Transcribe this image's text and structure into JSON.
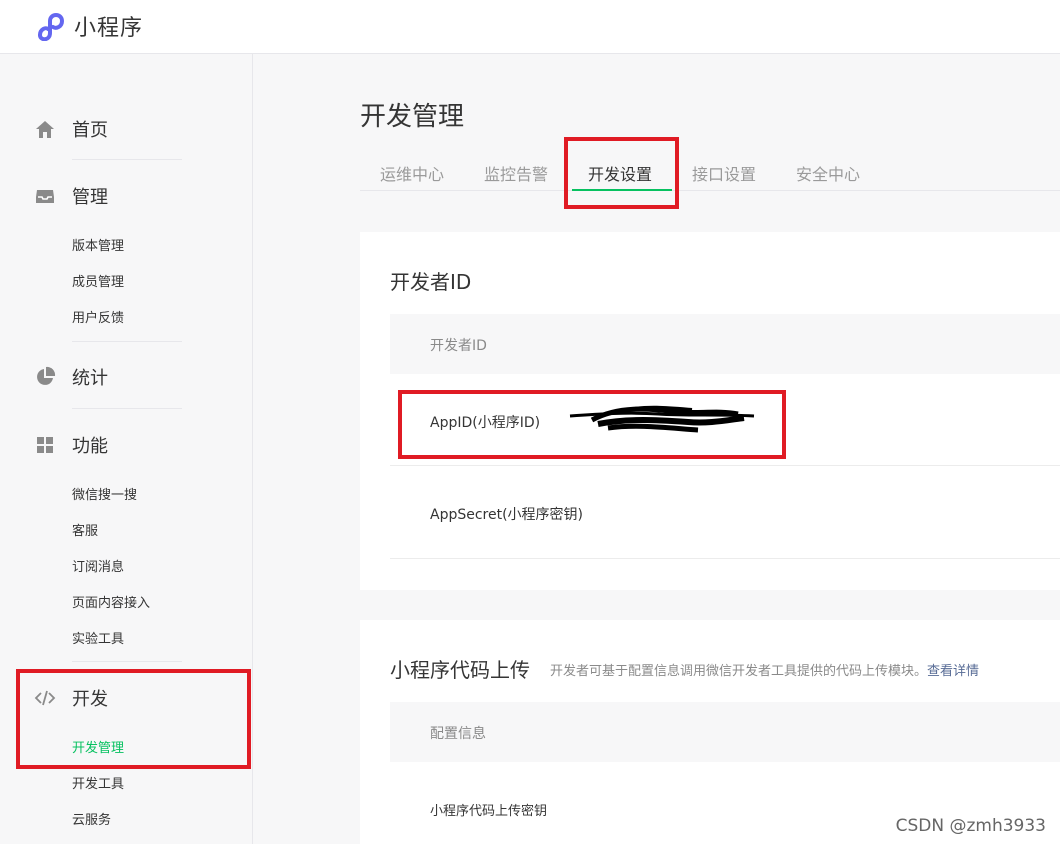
{
  "header": {
    "brand": "小程序"
  },
  "sidebar": {
    "groups": [
      {
        "title": "首页",
        "icon": "home-icon"
      },
      {
        "title": "管理",
        "icon": "inbox-icon",
        "items": [
          "版本管理",
          "成员管理",
          "用户反馈"
        ]
      },
      {
        "title": "统计",
        "icon": "pie-chart-icon"
      },
      {
        "title": "功能",
        "icon": "grid-icon",
        "items": [
          "微信搜一搜",
          "客服",
          "订阅消息",
          "页面内容接入",
          "实验工具"
        ]
      },
      {
        "title": "开发",
        "icon": "code-icon",
        "items": [
          "开发管理",
          "开发工具",
          "云服务"
        ],
        "active_item": "开发管理"
      }
    ]
  },
  "main": {
    "title": "开发管理",
    "tabs": [
      "运维中心",
      "监控告警",
      "开发设置",
      "接口设置",
      "安全中心"
    ],
    "active_tab": "开发设置",
    "developer_card": {
      "title": "开发者ID",
      "table_header": "开发者ID",
      "rows": [
        "AppID(小程序ID)",
        "AppSecret(小程序密钥)"
      ]
    },
    "upload_card": {
      "title": "小程序代码上传",
      "description": "开发者可基于配置信息调用微信开发者工具提供的代码上传模块。",
      "link": "查看详情",
      "table_header": "配置信息",
      "rows": [
        "小程序代码上传密钥"
      ]
    }
  },
  "watermark": "CSDN @zmh3933",
  "colors": {
    "accent_green": "#07c160",
    "highlight_red": "#e01b24",
    "link_blue": "#576b95",
    "logo_purple": "#6467f0"
  }
}
